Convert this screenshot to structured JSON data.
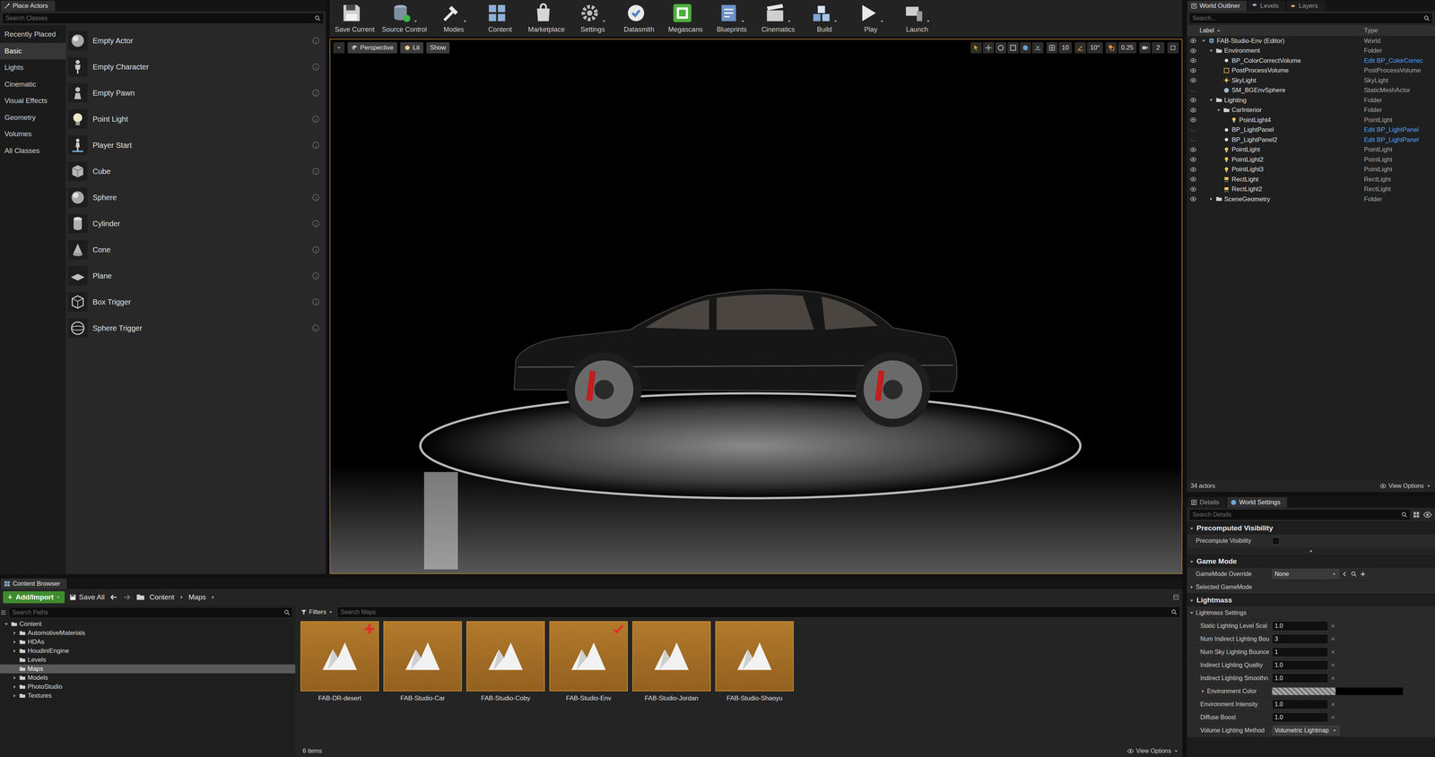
{
  "place_actors": {
    "title": "Place Actors",
    "search_placeholder": "Search Classes",
    "categories": [
      {
        "label": "Recently Placed",
        "selected": false
      },
      {
        "label": "Basic",
        "selected": true
      },
      {
        "label": "Lights",
        "selected": false
      },
      {
        "label": "Cinematic",
        "selected": false
      },
      {
        "label": "Visual Effects",
        "selected": false
      },
      {
        "label": "Geometry",
        "selected": false
      },
      {
        "label": "Volumes",
        "selected": false
      },
      {
        "label": "All Classes",
        "selected": false
      }
    ],
    "items": [
      {
        "label": "Empty Actor",
        "kind": "sphere"
      },
      {
        "label": "Empty Character",
        "kind": "character"
      },
      {
        "label": "Empty Pawn",
        "kind": "pawn"
      },
      {
        "label": "Point Light",
        "kind": "light"
      },
      {
        "label": "Player Start",
        "kind": "player"
      },
      {
        "label": "Cube",
        "kind": "cube"
      },
      {
        "label": "Sphere",
        "kind": "sphere"
      },
      {
        "label": "Cylinder",
        "kind": "cylinder"
      },
      {
        "label": "Cone",
        "kind": "cone"
      },
      {
        "label": "Plane",
        "kind": "plane"
      },
      {
        "label": "Box Trigger",
        "kind": "boxtrigger"
      },
      {
        "label": "Sphere Trigger",
        "kind": "spheretrigger"
      }
    ]
  },
  "toolbar": {
    "buttons": [
      {
        "label": "Save Current",
        "kind": "save",
        "dropdown": false
      },
      {
        "label": "Source Control",
        "kind": "source",
        "dropdown": true
      },
      {
        "label": "Modes",
        "kind": "modes",
        "dropdown": true
      },
      {
        "label": "Content",
        "kind": "content",
        "dropdown": false
      },
      {
        "label": "Marketplace",
        "kind": "market",
        "dropdown": false
      },
      {
        "label": "Settings",
        "kind": "settings",
        "dropdown": true
      },
      {
        "label": "Datasmith",
        "kind": "datasmith",
        "dropdown": false
      },
      {
        "label": "Megascans",
        "kind": "megascans",
        "dropdown": false
      },
      {
        "label": "Blueprints",
        "kind": "blueprints",
        "dropdown": true
      },
      {
        "label": "Cinematics",
        "kind": "cinematics",
        "dropdown": true
      },
      {
        "label": "Build",
        "kind": "build",
        "dropdown": true
      },
      {
        "label": "Play",
        "kind": "play",
        "dropdown": true
      },
      {
        "label": "Launch",
        "kind": "launch",
        "dropdown": true
      }
    ]
  },
  "viewport": {
    "view_buttons": [
      {
        "label": "Perspective"
      },
      {
        "label": "Lit"
      },
      {
        "label": "Show"
      }
    ],
    "snaps": [
      {
        "value": "10",
        "kind": "grid",
        "enabled": false
      },
      {
        "value": "10°",
        "kind": "rotate",
        "enabled": true
      },
      {
        "value": "0.25",
        "kind": "scale",
        "enabled": true
      },
      {
        "value": "2",
        "kind": "camera",
        "enabled": false
      }
    ]
  },
  "outliner": {
    "tabs": [
      {
        "label": "World Outliner",
        "selected": true
      },
      {
        "label": "Levels",
        "selected": false
      },
      {
        "label": "Layers",
        "selected": false
      }
    ],
    "search_placeholder": "Search...",
    "columns": [
      "Label",
      "Type"
    ],
    "rows": [
      {
        "label": "FAB-Studio-Env (Editor)",
        "type": "World",
        "depth": 0,
        "kind": "world",
        "toggle": "open",
        "visible": true,
        "type_link": false
      },
      {
        "label": "Environment",
        "type": "Folder",
        "depth": 1,
        "kind": "folder",
        "toggle": "open",
        "visible": true,
        "type_link": false
      },
      {
        "label": "BP_ColorCorrectVolume",
        "type": "Edit BP_ColorCorrec",
        "depth": 2,
        "kind": "bp",
        "toggle": "none",
        "visible": true,
        "type_link": true
      },
      {
        "label": "PostProcessVolume",
        "type": "PostProcessVolume",
        "depth": 2,
        "kind": "volume",
        "toggle": "none",
        "visible": true,
        "type_link": false
      },
      {
        "label": "SkyLight",
        "type": "SkyLight",
        "depth": 2,
        "kind": "sky",
        "toggle": "none",
        "visible": true,
        "type_link": false
      },
      {
        "label": "SM_BGEnvSphere",
        "type": "StaticMeshActor",
        "depth": 2,
        "kind": "mesh",
        "toggle": "none",
        "visible": false,
        "type_link": false
      },
      {
        "label": "Lighting",
        "type": "Folder",
        "depth": 1,
        "kind": "folder",
        "toggle": "open",
        "visible": true,
        "type_link": false
      },
      {
        "label": "CarInterior",
        "type": "Folder",
        "depth": 2,
        "kind": "folder",
        "toggle": "open",
        "visible": true,
        "type_link": false
      },
      {
        "label": "PointLight4",
        "type": "PointLight",
        "depth": 3,
        "kind": "light",
        "toggle": "none",
        "visible": true,
        "type_link": false
      },
      {
        "label": "BP_LightPanel",
        "type": "Edit BP_LightPanel",
        "depth": 2,
        "kind": "bp",
        "toggle": "none",
        "visible": false,
        "type_link": true
      },
      {
        "label": "BP_LightPanel2",
        "type": "Edit BP_LightPanel",
        "depth": 2,
        "kind": "bp",
        "toggle": "none",
        "visible": false,
        "type_link": true
      },
      {
        "label": "PointLight",
        "type": "PointLight",
        "depth": 2,
        "kind": "light",
        "toggle": "none",
        "visible": true,
        "type_link": false
      },
      {
        "label": "PointLight2",
        "type": "PointLight",
        "depth": 2,
        "kind": "light",
        "toggle": "none",
        "visible": true,
        "type_link": false
      },
      {
        "label": "PointLight3",
        "type": "PointLight",
        "depth": 2,
        "kind": "light",
        "toggle": "none",
        "visible": true,
        "type_link": false
      },
      {
        "label": "RectLight",
        "type": "RectLight",
        "depth": 2,
        "kind": "rectlight",
        "toggle": "none",
        "visible": true,
        "type_link": false
      },
      {
        "label": "RectLight2",
        "type": "RectLight",
        "depth": 2,
        "kind": "rectlight",
        "toggle": "none",
        "visible": true,
        "type_link": false
      },
      {
        "label": "SceneGeometry",
        "type": "Folder",
        "depth": 1,
        "kind": "folder",
        "toggle": "closed",
        "visible": true,
        "type_link": false
      }
    ],
    "count": "34 actors",
    "view_options": "View Options"
  },
  "details": {
    "tabs": [
      {
        "label": "Details",
        "selected": false
      },
      {
        "label": "World Settings",
        "selected": true
      }
    ],
    "search_placeholder": "Search Details",
    "sections": [
      {
        "title": "Precomputed Visibility",
        "advanced_toggle": true,
        "props": [
          {
            "label": "Precompute Visibility",
            "kind": "checkbox",
            "checked": false
          }
        ]
      },
      {
        "title": "Game Mode",
        "advanced_toggle": false,
        "props": [
          {
            "label": "GameMode Override",
            "kind": "dropdown",
            "value": "None"
          },
          {
            "label": "Selected GameMode",
            "kind": "group",
            "expanded": false
          }
        ]
      },
      {
        "title": "Lightmass",
        "advanced_toggle": false,
        "props": [
          {
            "label": "Lightmass Settings",
            "kind": "group",
            "expanded": true
          },
          {
            "label": "Static Lighting Level Scal",
            "kind": "number",
            "value": "1.0"
          },
          {
            "label": "Num Indirect Lighting Bou",
            "kind": "number",
            "value": "3"
          },
          {
            "label": "Num Sky Lighting Bounce",
            "kind": "number",
            "value": "1"
          },
          {
            "label": "Indirect Lighting Quality",
            "kind": "number",
            "value": "1.0"
          },
          {
            "label": "Indirect Lighting Smoothn",
            "kind": "number",
            "value": "1.0"
          },
          {
            "label": "Environment Color",
            "kind": "color",
            "expanded": false,
            "swatch": "#000000"
          },
          {
            "label": "Environment Intensity",
            "kind": "number",
            "value": "1.0"
          },
          {
            "label": "Diffuse Boost",
            "kind": "number",
            "value": "1.0"
          },
          {
            "label": "Volume Lighting Method",
            "kind": "dropdown",
            "value": "Volumetric Lightmap"
          }
        ]
      }
    ]
  },
  "content_browser": {
    "title": "Content Browser",
    "add_import": "Add/Import",
    "save_all": "Save All",
    "path": [
      "Content",
      "Maps"
    ],
    "paths_placeholder": "Search Paths",
    "tree": [
      {
        "label": "Content",
        "depth": 0,
        "toggle": "open",
        "selected": false
      },
      {
        "label": "AutomotiveMaterials",
        "depth": 1,
        "toggle": "closed",
        "selected": false
      },
      {
        "label": "HDAs",
        "depth": 1,
        "toggle": "closed",
        "selected": false
      },
      {
        "label": "HoudiniEngine",
        "depth": 1,
        "toggle": "closed",
        "selected": false
      },
      {
        "label": "Levels",
        "depth": 1,
        "toggle": "none",
        "selected": false
      },
      {
        "label": "Maps",
        "depth": 1,
        "toggle": "none",
        "selected": true
      },
      {
        "label": "Models",
        "depth": 1,
        "toggle": "closed",
        "selected": false
      },
      {
        "label": "PhotoStudio",
        "depth": 1,
        "toggle": "closed",
        "selected": false
      },
      {
        "label": "Textures",
        "depth": 1,
        "toggle": "closed",
        "selected": false
      }
    ],
    "filters": "Filters",
    "search_placeholder": "Search Maps",
    "assets": [
      {
        "label": "FAB-DR-desert",
        "scc": "add"
      },
      {
        "label": "FAB-Studio-Car",
        "scc": "none"
      },
      {
        "label": "FAB-Studio-Coby",
        "scc": "none"
      },
      {
        "label": "FAB-Studio-Env",
        "scc": "checked"
      },
      {
        "label": "FAB-Studio-Jordan",
        "scc": "none"
      },
      {
        "label": "FAB-Studio-Shaoyu",
        "scc": "none"
      }
    ],
    "count": "6 items",
    "view_options": "View Options"
  }
}
